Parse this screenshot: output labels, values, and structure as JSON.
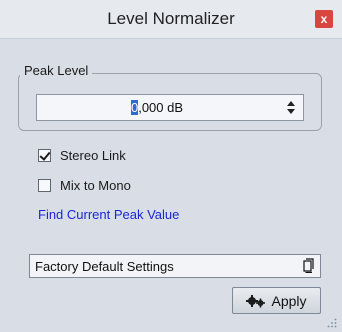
{
  "window": {
    "title": "Level Normalizer",
    "close_glyph": "x"
  },
  "peak_level": {
    "group_label": "Peak Level",
    "value_before_cursor": "0",
    "value_after_cursor": ",000 dB"
  },
  "options": {
    "stereo_link": {
      "label": "Stereo Link",
      "checked": true
    },
    "mix_to_mono": {
      "label": "Mix to Mono",
      "checked": false
    }
  },
  "find_peak_link": "Find Current Peak Value",
  "preset": {
    "label": "Factory Default Settings",
    "icon": "preset-menu-icon"
  },
  "apply_button": {
    "label": "Apply",
    "icon": "gears-icon"
  },
  "colors": {
    "close": "#d9463f",
    "link": "#1a25d6",
    "cursor_highlight": "#2f6bd6"
  }
}
